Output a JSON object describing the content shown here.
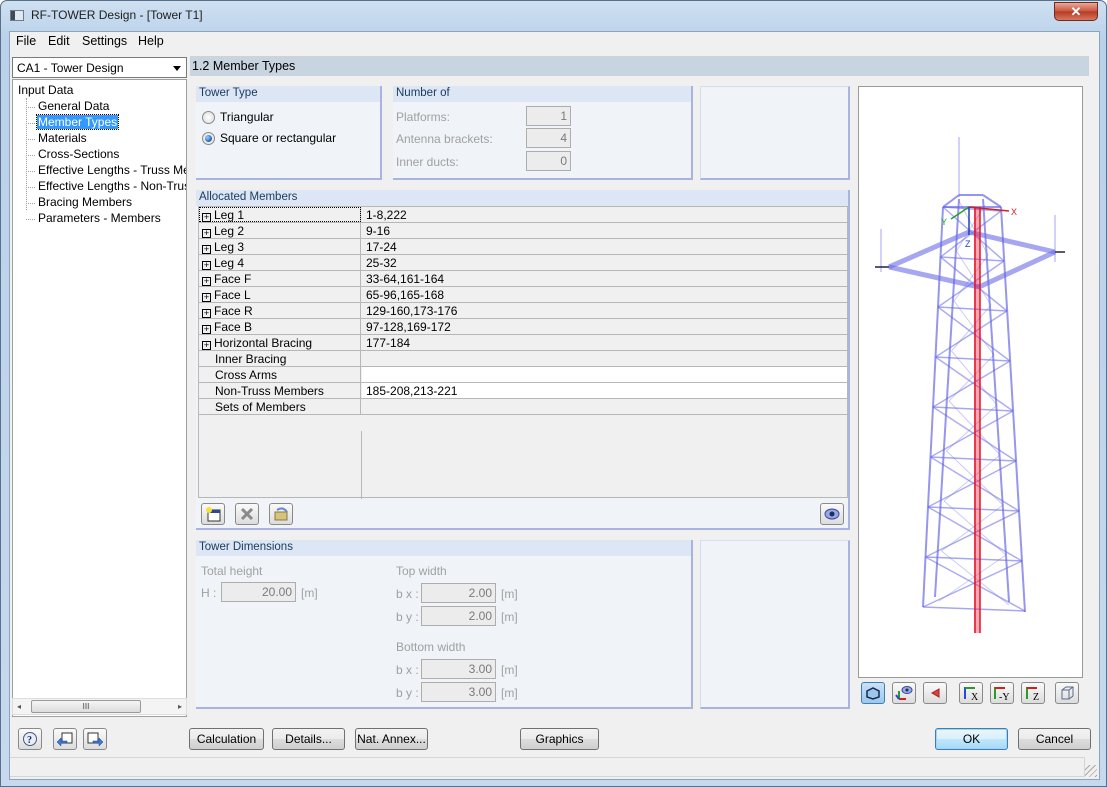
{
  "window": {
    "title": "RF-TOWER Design - [Tower T1]",
    "close_glyph": "✕"
  },
  "menu": [
    "File",
    "Edit",
    "Settings",
    "Help"
  ],
  "case_selector": {
    "value": "CA1 - Tower Design"
  },
  "navigator": {
    "root": "Input Data",
    "items": [
      {
        "label": "General Data",
        "selected": false
      },
      {
        "label": "Member Types",
        "selected": true
      },
      {
        "label": "Materials",
        "selected": false
      },
      {
        "label": "Cross-Sections",
        "selected": false
      },
      {
        "label": "Effective Lengths - Truss Members",
        "selected": false
      },
      {
        "label": "Effective Lengths - Non-Truss Members",
        "selected": false
      },
      {
        "label": "Bracing Members",
        "selected": false
      },
      {
        "label": "Parameters - Members",
        "selected": false
      }
    ],
    "scroll_thumb_glyph": "III",
    "scroll_left": "◂",
    "scroll_right": "▸"
  },
  "section_title": "1.2 Member Types",
  "tower_type": {
    "title": "Tower Type",
    "options": [
      {
        "label": "Triangular",
        "selected": false
      },
      {
        "label": "Square or rectangular",
        "selected": true
      }
    ]
  },
  "number_of": {
    "title": "Number of",
    "fields": [
      {
        "label": "Platforms:",
        "value": "1"
      },
      {
        "label": "Antenna brackets:",
        "value": "4"
      },
      {
        "label": "Inner ducts:",
        "value": "0"
      }
    ]
  },
  "allocated_members": {
    "title": "Allocated Members",
    "rows": [
      {
        "name": "Leg 1",
        "value": "1-8,222",
        "expandable": true
      },
      {
        "name": "Leg 2",
        "value": "9-16",
        "expandable": true
      },
      {
        "name": "Leg 3",
        "value": "17-24",
        "expandable": true
      },
      {
        "name": "Leg 4",
        "value": "25-32",
        "expandable": true
      },
      {
        "name": "Face F",
        "value": "33-64,161-164",
        "expandable": true
      },
      {
        "name": "Face L",
        "value": "65-96,165-168",
        "expandable": true
      },
      {
        "name": "Face R",
        "value": "129-160,173-176",
        "expandable": true
      },
      {
        "name": "Face B",
        "value": "97-128,169-172",
        "expandable": true
      },
      {
        "name": "Horizontal Bracing",
        "value": "177-184",
        "expandable": true
      },
      {
        "name": "Inner Bracing",
        "value": "",
        "expandable": false
      },
      {
        "name": "Cross Arms",
        "value": "",
        "expandable": false
      },
      {
        "name": "Non-Truss Members",
        "value": "185-208,213-221",
        "expandable": false
      },
      {
        "name": "Sets of Members",
        "value": "",
        "expandable": false
      }
    ]
  },
  "tower_dimensions": {
    "title": "Tower Dimensions",
    "total_height_label": "Total height",
    "h_label": "H :",
    "h_value": "20.00",
    "unit": "[m]",
    "top_width_label": "Top width",
    "top_bx_label": "b x :",
    "top_bx_value": "2.00",
    "top_by_label": "b y :",
    "top_by_value": "2.00",
    "bottom_width_label": "Bottom width",
    "bottom_bx_label": "b x :",
    "bottom_bx_value": "3.00",
    "bottom_by_label": "b y :",
    "bottom_by_value": "3.00"
  },
  "preview": {
    "axis_x": "X",
    "axis_y": "Y",
    "axis_z": "Z",
    "toolbar": [
      "view-mode",
      "show-axes",
      "render-toggle",
      "view-x",
      "view-minus-y",
      "view-z",
      "iso-view"
    ],
    "view_x_label": "X",
    "view_y_label": "-Y",
    "view_z_label": "Z"
  },
  "buttons": {
    "calculation": "Calculation",
    "details": "Details...",
    "nat_annex": "Nat. Annex...",
    "graphics": "Graphics",
    "ok": "OK",
    "cancel": "Cancel"
  },
  "colors": {
    "tower_members": "#6a6ae8",
    "highlight_member": "#e8102a",
    "selection": "#3399ff"
  }
}
